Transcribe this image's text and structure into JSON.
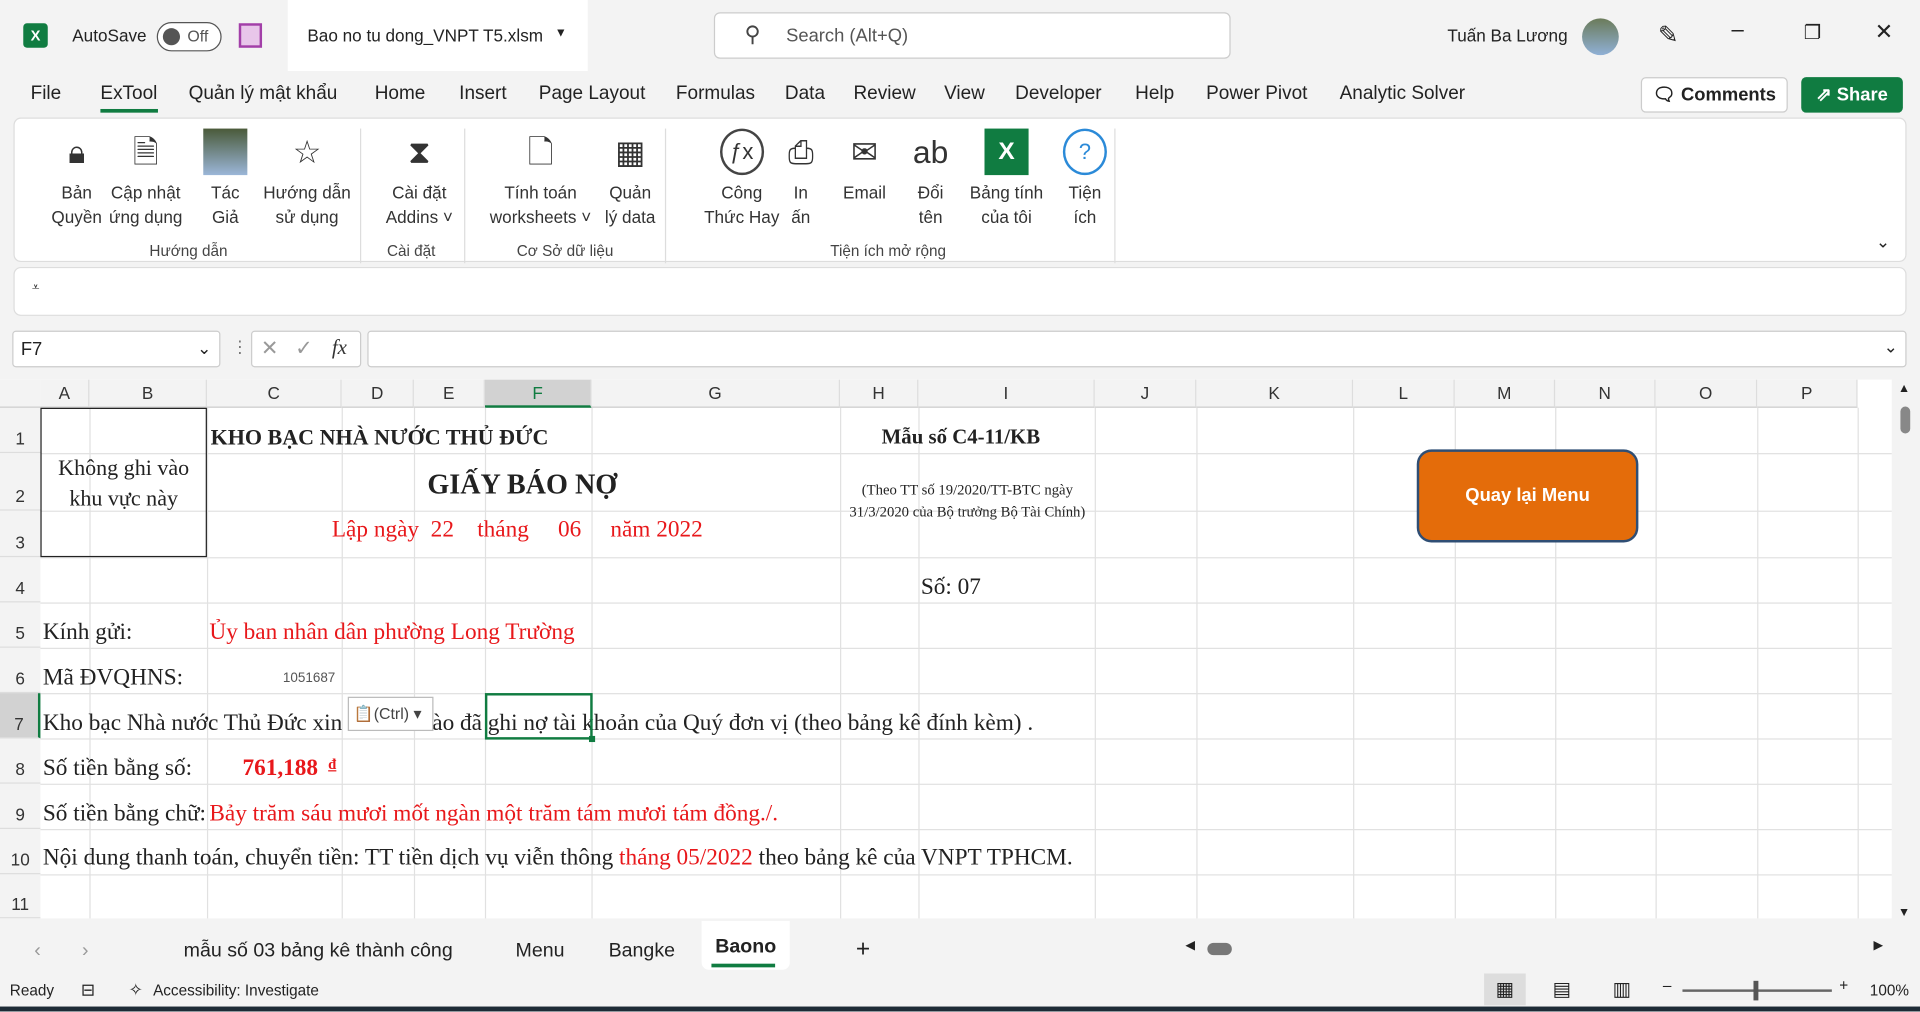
{
  "titlebar": {
    "autosave_label": "AutoSave",
    "autosave_state": "Off",
    "filename": "Bao no tu dong_VNPT T5.xlsm",
    "search_placeholder": "Search (Alt+Q)",
    "user": "Tuấn Ba Lương"
  },
  "menu": [
    "File",
    "ExTool",
    "Quản lý mật khẩu",
    "Home",
    "Insert",
    "Page Layout",
    "Formulas",
    "Data",
    "Review",
    "View",
    "Developer",
    "Help",
    "Power Pivot",
    "Analytic Solver"
  ],
  "comments_label": "Comments",
  "share_label": "Share",
  "ribbon": {
    "buttons": [
      {
        "l1": "Bản",
        "l2": "Quyền",
        "icon": "lock-icon"
      },
      {
        "l1": "Cập nhật",
        "l2": "ứng dụng",
        "icon": "update-icon"
      },
      {
        "l1": "Tác",
        "l2": "Giả",
        "icon": "author-photo-icon"
      },
      {
        "l1": "Hướng dẫn",
        "l2": "sử dụng",
        "icon": "guide-book-icon"
      },
      {
        "l1": "Cài đặt",
        "l2": "Addins ˅",
        "icon": "hourglass-icon"
      },
      {
        "l1": "Tính toán",
        "l2": "worksheets ˅",
        "icon": "recalc-icon"
      },
      {
        "l1": "Quản",
        "l2": "lý data",
        "icon": "database-icon"
      },
      {
        "l1": "Công",
        "l2": "Thức Hay",
        "icon": "function-icon"
      },
      {
        "l1": "In",
        "l2": "ấn",
        "icon": "printer-icon"
      },
      {
        "l1": "Email",
        "l2": "",
        "icon": "email-icon"
      },
      {
        "l1": "Đổi",
        "l2": "tên",
        "icon": "rename-icon"
      },
      {
        "l1": "Bảng tính",
        "l2": "của tôi",
        "icon": "excel-icon"
      },
      {
        "l1": "Tiện",
        "l2": "ích",
        "icon": "help-icon"
      }
    ],
    "groups": [
      "Hướng dẫn",
      "Cài đặt",
      "Cơ Sở dữ liệu",
      "Tiện ích mở rộng"
    ]
  },
  "formula_bar": {
    "name_box": "F7",
    "fx": "fx",
    "value": ""
  },
  "columns": [
    "A",
    "B",
    "C",
    "D",
    "E",
    "F",
    "G",
    "H",
    "I",
    "J",
    "K",
    "L",
    "M",
    "N",
    "O",
    "P"
  ],
  "rows": [
    "1",
    "2",
    "3",
    "4",
    "5",
    "6",
    "7",
    "8",
    "9",
    "10",
    "11"
  ],
  "sheet": {
    "no_write": "Không ghi vào khu vực này",
    "org": "KHO BẠC NHÀ NƯỚC THỦ ĐỨC",
    "form_no": "Mẫu số C4-11/KB",
    "title": "GIẤY BÁO NỢ",
    "basis": "(Theo TT số 19/2020/TT-BTC ngày 31/3/2020 của Bộ trưởng Bộ Tài Chính)",
    "date": "Lập ngày  22    tháng     06     năm 2022",
    "number": "Số: 07",
    "to_label": "Kính gửi:",
    "to_value": "Ủy ban nhân dân phường Long Trường",
    "code_label": "Mã ĐVQHNS:",
    "code_value": "1051687",
    "r7_a": "Kho bạc Nhà nước Thủ Đức xin",
    "r7_b": "ào đã ghi nợ tài khoản của Quý đơn vị (theo bảng kê đính kèm) .",
    "paste_ctrl": "(Ctrl)",
    "amount_label": "Số tiền bằng số:",
    "amount_value": "761,188",
    "currency": "đ",
    "words_label": "Số tiền bằng chữ:",
    "words_value": "Bảy trăm sáu mươi mốt ngàn một trăm tám mươi tám đồng./.",
    "content_a": "Nội dung thanh toán, chuyển tiền: TT tiền dịch vụ viễn thông ",
    "content_b": "tháng 05/2022",
    "content_c": " theo bảng kê của VNPT TPHCM.",
    "back_button": "Quay lại Menu"
  },
  "sheet_tabs": [
    "mẫu số 03 bảng kê thành công",
    "Menu",
    "Bangke",
    "Baono"
  ],
  "active_tab": "Baono",
  "status": {
    "ready": "Ready",
    "accessibility": "Accessibility: Investigate",
    "zoom": "100%"
  },
  "colors": {
    "excel_green": "#107c41",
    "red": "#e8181b",
    "button_orange": "#e46c0a"
  }
}
